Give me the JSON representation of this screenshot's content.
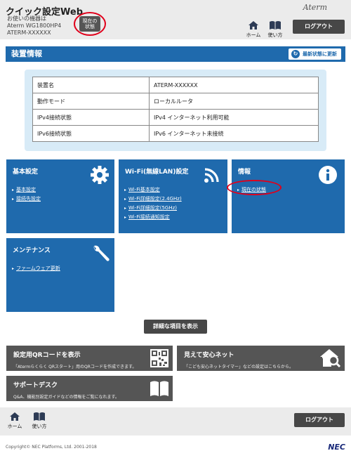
{
  "header": {
    "title": "クイック設定Web",
    "device_line1": "お使いの機器は",
    "device_line2": "Aterm WG1800HP4",
    "device_line3": "ATERM-XXXXXX",
    "status_button_line1": "現在の",
    "status_button_line2": "状態",
    "brand": "Aterm",
    "home_label": "ホーム",
    "manual_label": "使い方",
    "logout_label": "ログアウト"
  },
  "section": {
    "title": "装置情報",
    "refresh_label": "最新状態に更新"
  },
  "device_table": [
    {
      "key": "装置名",
      "value": "ATERM-XXXXXX"
    },
    {
      "key": "動作モード",
      "value": "ローカルルータ"
    },
    {
      "key": "IPv4接続状態",
      "value": "IPv4 インターネット利用可能"
    },
    {
      "key": "IPv6接続状態",
      "value": "IPv6 インターネット未接続"
    }
  ],
  "tiles": {
    "basic": {
      "title": "基本設定",
      "icon": "gear-icon",
      "links": [
        "基本設定",
        "接続先設定"
      ]
    },
    "wifi": {
      "title": "Wi-Fi(無線LAN)設定",
      "icon": "wifi-icon",
      "links": [
        "Wi-Fi基本設定",
        "Wi-Fi詳細設定(2.4GHz)",
        "Wi-Fi詳細設定(5GHz)",
        "Wi-Fi接続通知設定"
      ]
    },
    "info": {
      "title": "情報",
      "icon": "info-icon",
      "links": [
        "現在の状態"
      ]
    },
    "maintenance": {
      "title": "メンテナンス",
      "icon": "wrench-icon",
      "links": [
        "ファームウェア更新"
      ]
    }
  },
  "detail_button_label": "詳細な項目を表示",
  "cards": {
    "qr": {
      "title": "設定用QRコードを表示",
      "desc": "「Atermらくらく QRスタート」用のQRコードを作成できます。",
      "icon": "qr-code-icon"
    },
    "safety": {
      "title": "見えて安心ネット",
      "desc": "「こども安心ネットタイマー」などの設定はこちらから。",
      "icon": "house-search-icon"
    },
    "support": {
      "title": "サポートデスク",
      "desc": "Q&A、機能別設定ガイドなどの情報をご覧になれます。",
      "icon": "book-icon"
    }
  },
  "footer": {
    "home_label": "ホーム",
    "manual_label": "使い方",
    "logout_label": "ログアウト",
    "copyright": "Copyright© NEC Platforms, Ltd. 2001-2018",
    "logo": "NEC"
  },
  "colors": {
    "accent_blue": "#1f6aad",
    "panel_light_blue": "#d8ebf7",
    "highlight_red": "#e0001b",
    "card_gray": "#555555"
  }
}
